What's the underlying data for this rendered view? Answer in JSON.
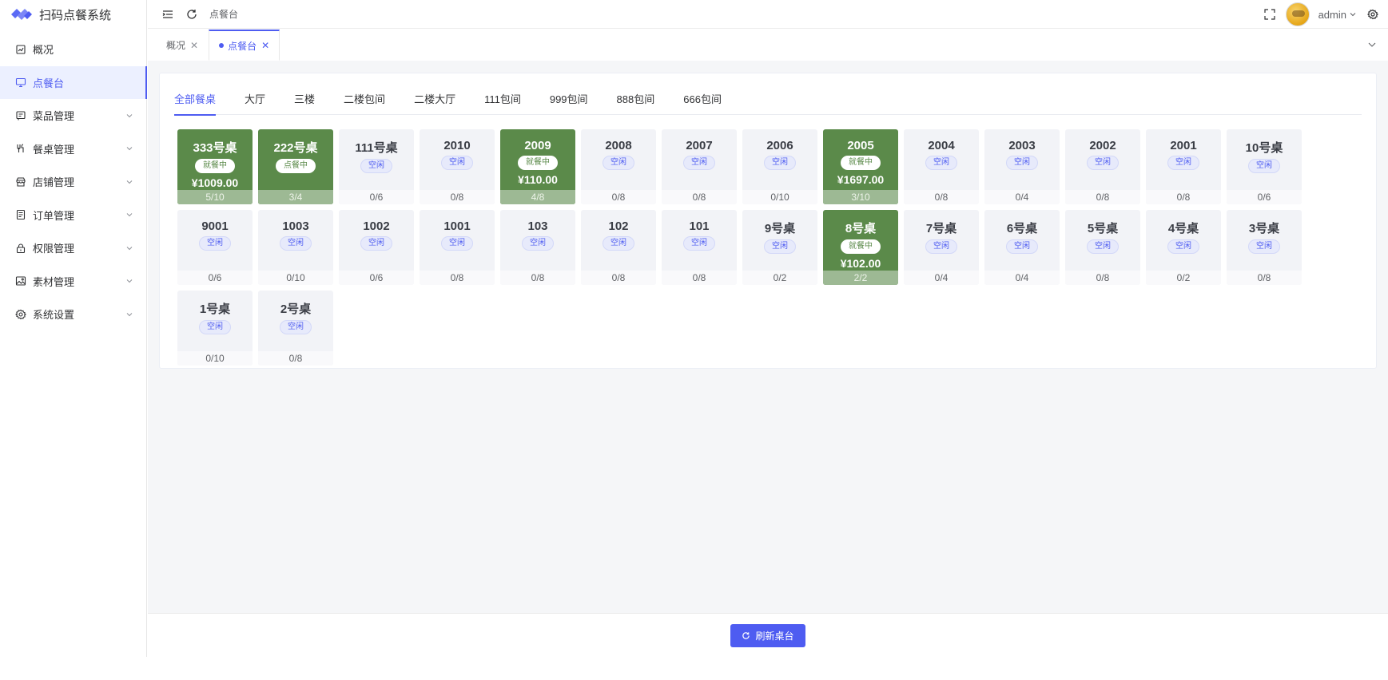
{
  "app": {
    "title": "扫码点餐系统"
  },
  "sidebar": {
    "items": [
      {
        "label": "概况",
        "icon": "dashboard-icon",
        "active": false,
        "expandable": false
      },
      {
        "label": "点餐台",
        "icon": "monitor-icon",
        "active": true,
        "expandable": false
      },
      {
        "label": "菜品管理",
        "icon": "message-square-icon",
        "active": false,
        "expandable": true
      },
      {
        "label": "餐桌管理",
        "icon": "utensils-icon",
        "active": false,
        "expandable": true
      },
      {
        "label": "店铺管理",
        "icon": "store-icon",
        "active": false,
        "expandable": true
      },
      {
        "label": "订单管理",
        "icon": "document-icon",
        "active": false,
        "expandable": true
      },
      {
        "label": "权限管理",
        "icon": "lock-icon",
        "active": false,
        "expandable": true
      },
      {
        "label": "素材管理",
        "icon": "image-icon",
        "active": false,
        "expandable": true
      },
      {
        "label": "系统设置",
        "icon": "gear-icon",
        "active": false,
        "expandable": true
      }
    ]
  },
  "header": {
    "breadcrumb": "点餐台",
    "user": "admin"
  },
  "tabs": [
    {
      "label": "概况",
      "active": false
    },
    {
      "label": "点餐台",
      "active": true
    }
  ],
  "categories": [
    "全部餐桌",
    "大厅",
    "三楼",
    "二楼包间",
    "二楼大厅",
    "111包间",
    "999包间",
    "888包间",
    "666包间"
  ],
  "active_category": 0,
  "tables": [
    {
      "name": "333号桌",
      "status": "就餐中",
      "amount": "¥1009.00",
      "seats": "5/10",
      "busy": true
    },
    {
      "name": "222号桌",
      "status": "点餐中",
      "amount": "",
      "seats": "3/4",
      "busy": true
    },
    {
      "name": "111号桌",
      "status": "空闲",
      "amount": "",
      "seats": "0/6",
      "busy": false
    },
    {
      "name": "2010",
      "status": "空闲",
      "amount": "",
      "seats": "0/8",
      "busy": false
    },
    {
      "name": "2009",
      "status": "就餐中",
      "amount": "¥110.00",
      "seats": "4/8",
      "busy": true
    },
    {
      "name": "2008",
      "status": "空闲",
      "amount": "",
      "seats": "0/8",
      "busy": false
    },
    {
      "name": "2007",
      "status": "空闲",
      "amount": "",
      "seats": "0/8",
      "busy": false
    },
    {
      "name": "2006",
      "status": "空闲",
      "amount": "",
      "seats": "0/10",
      "busy": false
    },
    {
      "name": "2005",
      "status": "就餐中",
      "amount": "¥1697.00",
      "seats": "3/10",
      "busy": true
    },
    {
      "name": "2004",
      "status": "空闲",
      "amount": "",
      "seats": "0/8",
      "busy": false
    },
    {
      "name": "2003",
      "status": "空闲",
      "amount": "",
      "seats": "0/4",
      "busy": false
    },
    {
      "name": "2002",
      "status": "空闲",
      "amount": "",
      "seats": "0/8",
      "busy": false
    },
    {
      "name": "2001",
      "status": "空闲",
      "amount": "",
      "seats": "0/8",
      "busy": false
    },
    {
      "name": "10号桌",
      "status": "空闲",
      "amount": "",
      "seats": "0/6",
      "busy": false
    },
    {
      "name": "9001",
      "status": "空闲",
      "amount": "",
      "seats": "0/6",
      "busy": false
    },
    {
      "name": "1003",
      "status": "空闲",
      "amount": "",
      "seats": "0/10",
      "busy": false
    },
    {
      "name": "1002",
      "status": "空闲",
      "amount": "",
      "seats": "0/6",
      "busy": false
    },
    {
      "name": "1001",
      "status": "空闲",
      "amount": "",
      "seats": "0/8",
      "busy": false
    },
    {
      "name": "103",
      "status": "空闲",
      "amount": "",
      "seats": "0/8",
      "busy": false
    },
    {
      "name": "102",
      "status": "空闲",
      "amount": "",
      "seats": "0/8",
      "busy": false
    },
    {
      "name": "101",
      "status": "空闲",
      "amount": "",
      "seats": "0/8",
      "busy": false
    },
    {
      "name": "9号桌",
      "status": "空闲",
      "amount": "",
      "seats": "0/2",
      "busy": false
    },
    {
      "name": "8号桌",
      "status": "就餐中",
      "amount": "¥102.00",
      "seats": "2/2",
      "busy": true
    },
    {
      "name": "7号桌",
      "status": "空闲",
      "amount": "",
      "seats": "0/4",
      "busy": false
    },
    {
      "name": "6号桌",
      "status": "空闲",
      "amount": "",
      "seats": "0/4",
      "busy": false
    },
    {
      "name": "5号桌",
      "status": "空闲",
      "amount": "",
      "seats": "0/8",
      "busy": false
    },
    {
      "name": "4号桌",
      "status": "空闲",
      "amount": "",
      "seats": "0/2",
      "busy": false
    },
    {
      "name": "3号桌",
      "status": "空闲",
      "amount": "",
      "seats": "0/8",
      "busy": false
    },
    {
      "name": "1号桌",
      "status": "空闲",
      "amount": "",
      "seats": "0/10",
      "busy": false
    },
    {
      "name": "2号桌",
      "status": "空闲",
      "amount": "",
      "seats": "0/8",
      "busy": false
    }
  ],
  "footer": {
    "refresh_label": "刷新桌台"
  },
  "colors": {
    "accent": "#4e5cf1",
    "busy_green": "#5b8a4a",
    "busy_footer": "#9db994",
    "idle_bg": "#f2f3f7"
  }
}
